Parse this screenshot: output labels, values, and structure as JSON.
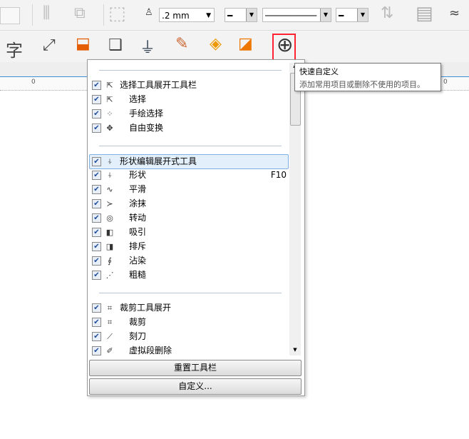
{
  "toolbar1": {
    "outline_width": ".2 mm"
  },
  "toolbar2": {
    "char_icon": "字"
  },
  "ruler": {
    "ticks": [
      "0",
      "0"
    ]
  },
  "menu": {
    "groups": [
      {
        "items": [
          {
            "label": "选择工具展开工具栏",
            "icon": "pointer-icon",
            "checked": true,
            "header": true
          },
          {
            "label": "选择",
            "icon": "pointer-icon",
            "checked": true
          },
          {
            "label": "手绘选择",
            "icon": "freehand-pick-icon",
            "checked": true
          },
          {
            "label": "自由变换",
            "icon": "free-transform-icon",
            "checked": true
          }
        ]
      },
      {
        "items": [
          {
            "label": "形状编辑展开式工具",
            "icon": "shape-icon",
            "checked": true,
            "header": true
          },
          {
            "label": "形状",
            "icon": "shape-icon",
            "checked": true,
            "shortcut": "F10"
          },
          {
            "label": "平滑",
            "icon": "smooth-icon",
            "checked": true
          },
          {
            "label": "涂抹",
            "icon": "smear-icon",
            "checked": true
          },
          {
            "label": "转动",
            "icon": "twirl-icon",
            "checked": true
          },
          {
            "label": "吸引",
            "icon": "attract-icon",
            "checked": true
          },
          {
            "label": "排斥",
            "icon": "repel-icon",
            "checked": true
          },
          {
            "label": "沾染",
            "icon": "smudge-icon",
            "checked": true
          },
          {
            "label": "粗糙",
            "icon": "roughen-icon",
            "checked": true
          }
        ]
      },
      {
        "items": [
          {
            "label": "裁剪工具展开",
            "icon": "crop-icon",
            "checked": true,
            "header": true
          },
          {
            "label": "裁剪",
            "icon": "crop-icon",
            "checked": true
          },
          {
            "label": "刻刀",
            "icon": "knife-icon",
            "checked": true
          },
          {
            "label": "虚拟段删除",
            "icon": "virtual-segment-delete-icon",
            "checked": true
          }
        ]
      }
    ],
    "reset_label": "重置工具栏",
    "customize_label": "自定义..."
  },
  "tooltip": {
    "title": "快速自定义",
    "description": "添加常用项目或删除不使用的项目。"
  }
}
